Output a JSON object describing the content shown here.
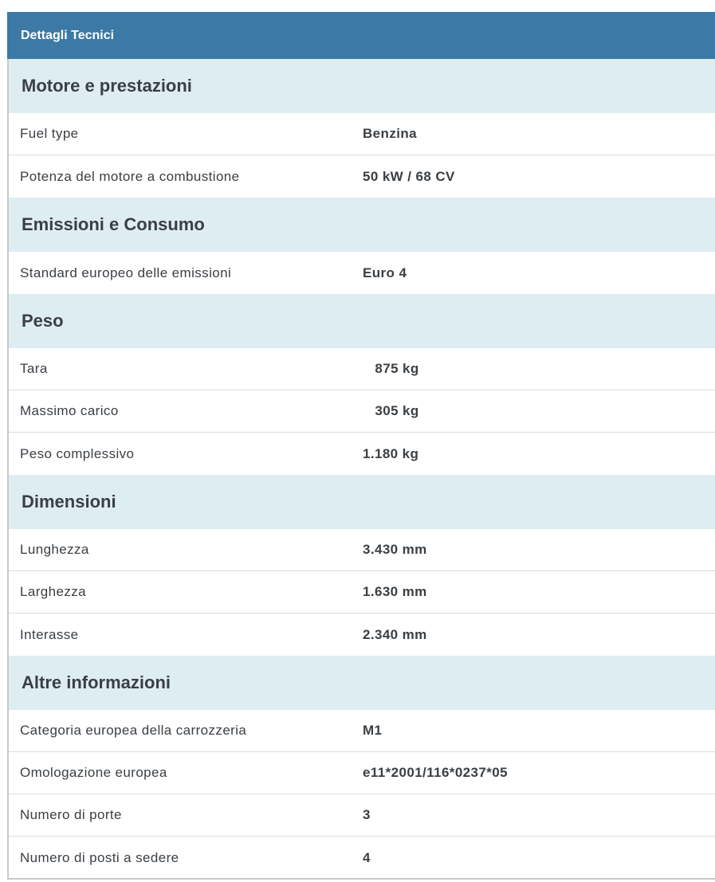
{
  "header": {
    "title": "Dettagli Tecnici"
  },
  "sections": [
    {
      "title": "Motore e prestazioni",
      "rows": [
        {
          "label": "Fuel type",
          "value": "Benzina"
        },
        {
          "label": "Potenza del motore a combustione",
          "value": "50 kW / 68 CV"
        }
      ]
    },
    {
      "title": "Emissioni e Consumo",
      "rows": [
        {
          "label": "Standard europeo delle emissioni",
          "value": "Euro 4"
        }
      ]
    },
    {
      "title": "Peso",
      "rows": [
        {
          "label": "Tara",
          "value": "   875 kg"
        },
        {
          "label": "Massimo carico",
          "value": "   305 kg"
        },
        {
          "label": "Peso complessivo",
          "value": "1.180 kg"
        }
      ]
    },
    {
      "title": "Dimensioni",
      "rows": [
        {
          "label": "Lunghezza",
          "value": "3.430 mm"
        },
        {
          "label": "Larghezza",
          "value": "1.630 mm"
        },
        {
          "label": "Interasse",
          "value": "2.340 mm"
        }
      ]
    },
    {
      "title": "Altre informazioni",
      "rows": [
        {
          "label": "Categoria europea della carrozzeria",
          "value": "M1"
        },
        {
          "label": "Omologazione europea",
          "value": "e11*2001/116*0237*05"
        },
        {
          "label": "Numero di porte",
          "value": "3"
        },
        {
          "label": "Numero di posti a sedere",
          "value": "4"
        }
      ]
    }
  ],
  "colors": {
    "header_bg": "#3d79a5",
    "section_bg": "#deedf2",
    "text": "#3a3f44"
  }
}
